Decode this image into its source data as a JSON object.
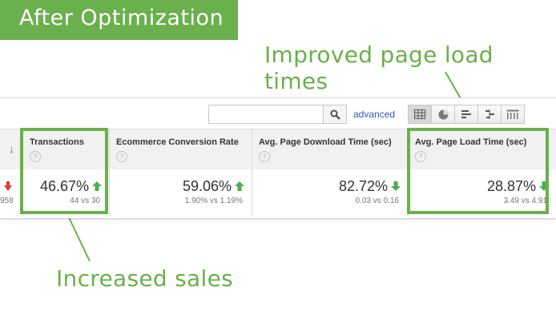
{
  "banner": {
    "title": "After Optimization"
  },
  "annotations": {
    "top": "Improved page load times",
    "bottom": "Increased sales"
  },
  "toolbar": {
    "search_value": "",
    "advanced_label": "advanced",
    "view_icons": [
      "table-view-icon",
      "pie-view-icon",
      "performance-view-icon",
      "comparison-view-icon",
      "pivot-view-icon"
    ]
  },
  "table": {
    "left_cut": {
      "sub": "958"
    },
    "columns": [
      {
        "header": "Transactions",
        "help": "?",
        "value": "46.67%",
        "sub": "44 vs 30",
        "trend": "up"
      },
      {
        "header": "Ecommerce Conversion Rate",
        "help": "?",
        "value": "59.06%",
        "sub": "1.90% vs 1.19%",
        "trend": "up"
      },
      {
        "header": "Avg. Page Download Time (sec)",
        "help": "?",
        "value": "82.72%",
        "sub": "0.03 vs 0.16",
        "trend": "down"
      },
      {
        "header": "Avg. Page Load Time (sec)",
        "help": "?",
        "value": "28.87%",
        "sub": "3.49 vs 4.91",
        "trend": "down"
      }
    ]
  },
  "colors": {
    "accent_green": "#6ab04c",
    "link_blue": "#2a5db0",
    "trend_green": "#4caf50",
    "trend_red": "#e53935"
  }
}
